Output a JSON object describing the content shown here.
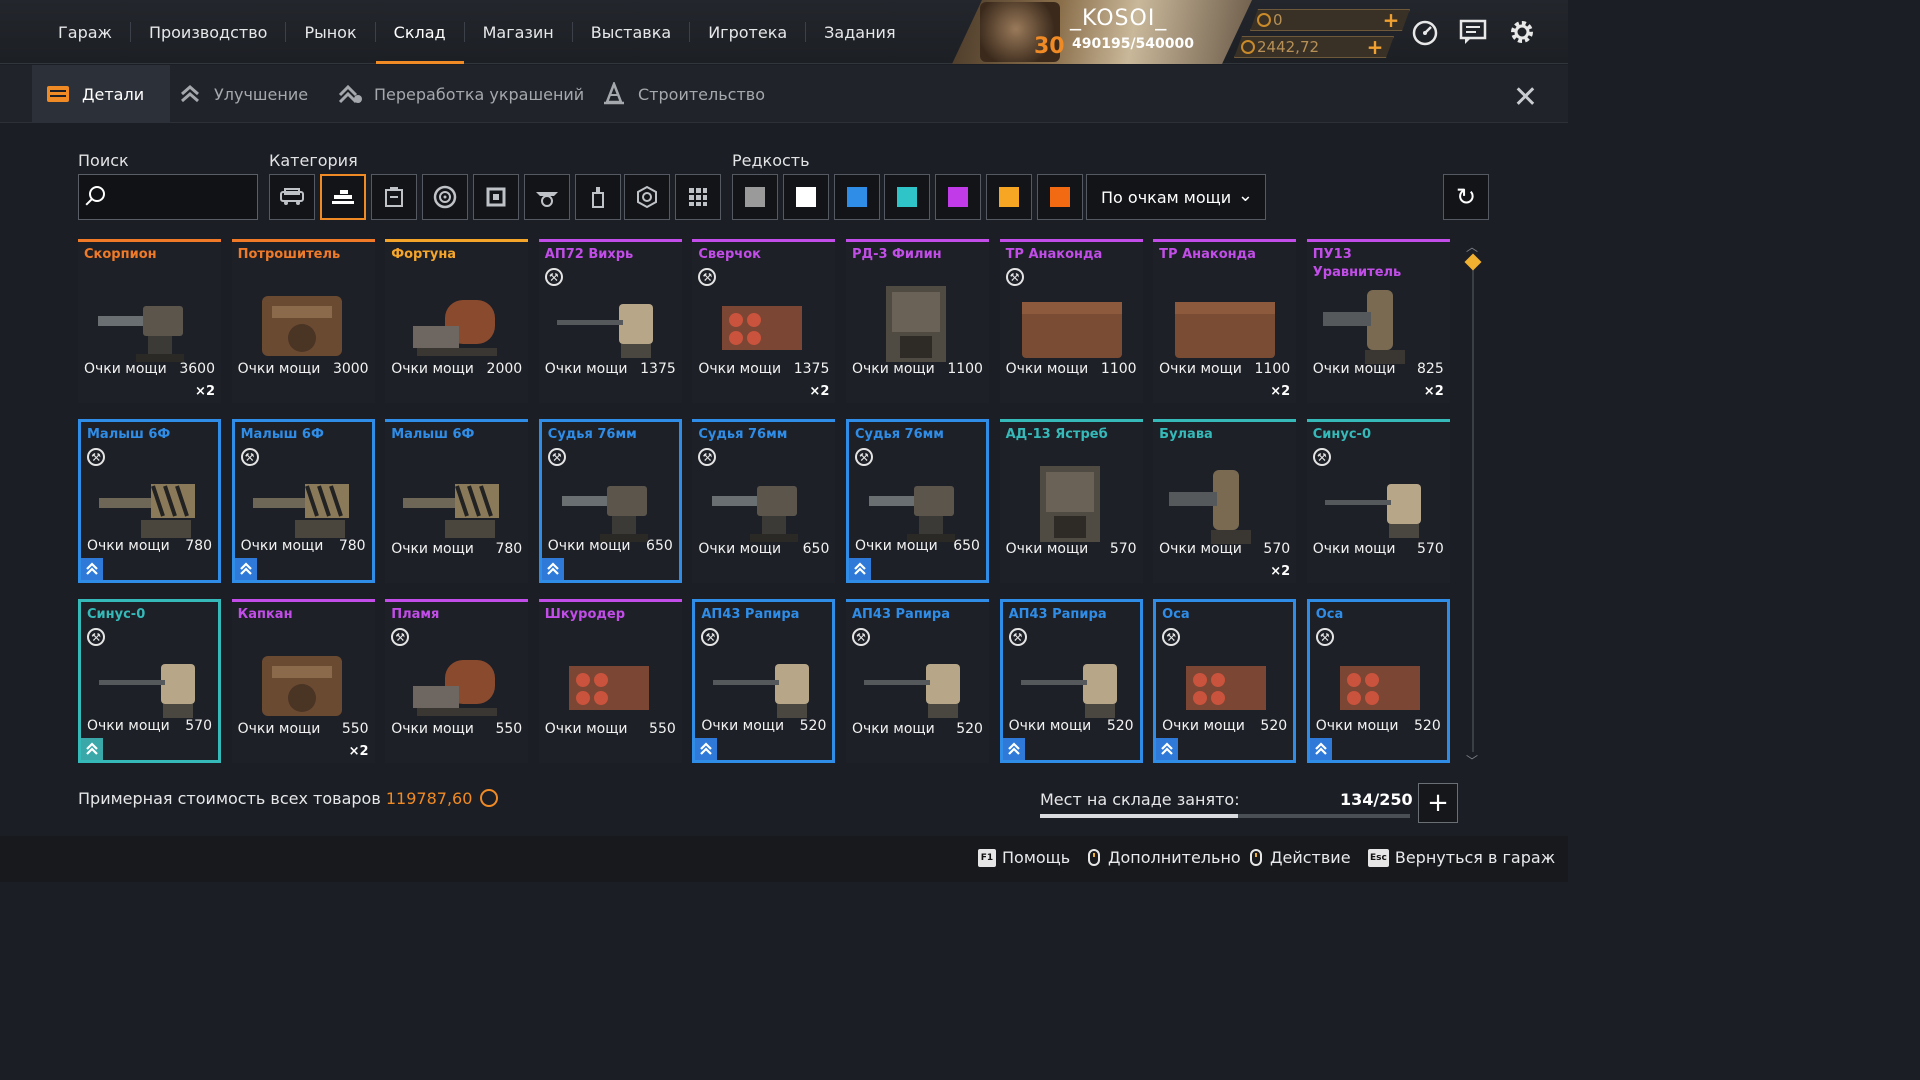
{
  "nav": {
    "items": [
      "Гараж",
      "Производство",
      "Рынок",
      "Склад",
      "Магазин",
      "Выставка",
      "Игротека",
      "Задания"
    ],
    "active_index": 3
  },
  "profile": {
    "level": "30",
    "name": "_KOSOI_",
    "xp": "490195/540000"
  },
  "currencies": [
    {
      "value": "0",
      "icon": "coin-icon"
    },
    {
      "value": "2442,72",
      "icon": "coin-icon"
    }
  ],
  "subtabs": [
    "Детали",
    "Улучшение",
    "Переработка украшений",
    "Строительство"
  ],
  "filters": {
    "search_label": "Поиск",
    "category_label": "Категория",
    "rarity_label": "Редкость",
    "sort_value": "По очкам мощи",
    "rarity_colors": [
      "#9a9a9a",
      "#ffffff",
      "#2f8de8",
      "#2ec4c8",
      "#c23be8",
      "#f6a623",
      "#f26a12"
    ]
  },
  "power_label": "Очки мощи",
  "items": [
    {
      "name": "Скорпион",
      "power": "3600",
      "count": "×2",
      "rarity": "#f07a28",
      "nocraft": false,
      "framed": false,
      "upgradable": false
    },
    {
      "name": "Потрошитель",
      "power": "3000",
      "count": "",
      "rarity": "#f07a28",
      "nocraft": false,
      "framed": false,
      "upgradable": false
    },
    {
      "name": "Фортуна",
      "power": "2000",
      "count": "",
      "rarity": "#f5a62a",
      "nocraft": false,
      "framed": false,
      "upgradable": false
    },
    {
      "name": "АП72 Вихрь",
      "power": "1375",
      "count": "",
      "rarity": "#c24de8",
      "nocraft": true,
      "framed": false,
      "upgradable": false
    },
    {
      "name": "Сверчок",
      "power": "1375",
      "count": "×2",
      "rarity": "#c24de8",
      "nocraft": true,
      "framed": false,
      "upgradable": false
    },
    {
      "name": "РД-3 Филин",
      "power": "1100",
      "count": "",
      "rarity": "#c24de8",
      "nocraft": false,
      "framed": false,
      "upgradable": false
    },
    {
      "name": "ТР Анаконда",
      "power": "1100",
      "count": "",
      "rarity": "#c24de8",
      "nocraft": true,
      "framed": false,
      "upgradable": false
    },
    {
      "name": "ТР Анаконда",
      "power": "1100",
      "count": "×2",
      "rarity": "#c24de8",
      "nocraft": false,
      "framed": false,
      "upgradable": false
    },
    {
      "name": "ПУ13 Уравнитель",
      "power": "825",
      "count": "×2",
      "rarity": "#c24de8",
      "nocraft": false,
      "framed": false,
      "upgradable": false
    },
    {
      "name": "Малыш 6Ф",
      "power": "780",
      "count": "",
      "rarity": "#2f8de8",
      "nocraft": true,
      "framed": true,
      "upgradable": true
    },
    {
      "name": "Малыш 6Ф",
      "power": "780",
      "count": "",
      "rarity": "#2f8de8",
      "nocraft": true,
      "framed": true,
      "upgradable": true
    },
    {
      "name": "Малыш 6Ф",
      "power": "780",
      "count": "",
      "rarity": "#2f8de8",
      "nocraft": false,
      "framed": false,
      "upgradable": false
    },
    {
      "name": "Судья 76мм",
      "power": "650",
      "count": "",
      "rarity": "#2f8de8",
      "nocraft": true,
      "framed": true,
      "upgradable": true
    },
    {
      "name": "Судья 76мм",
      "power": "650",
      "count": "",
      "rarity": "#2f8de8",
      "nocraft": true,
      "framed": false,
      "upgradable": false
    },
    {
      "name": "Судья 76мм",
      "power": "650",
      "count": "",
      "rarity": "#2f8de8",
      "nocraft": true,
      "framed": true,
      "upgradable": true
    },
    {
      "name": "АД-13 Ястреб",
      "power": "570",
      "count": "",
      "rarity": "#35b9b9",
      "nocraft": false,
      "framed": false,
      "upgradable": false
    },
    {
      "name": "Булава",
      "power": "570",
      "count": "×2",
      "rarity": "#35b9b9",
      "nocraft": false,
      "framed": false,
      "upgradable": false
    },
    {
      "name": "Синус-0",
      "power": "570",
      "count": "",
      "rarity": "#35b9b9",
      "nocraft": true,
      "framed": false,
      "upgradable": false
    },
    {
      "name": "Синус-0",
      "power": "570",
      "count": "",
      "rarity": "#35b9b9",
      "nocraft": true,
      "framed": true,
      "upgradable": true
    },
    {
      "name": "Капкан",
      "power": "550",
      "count": "×2",
      "rarity": "#c24de8",
      "nocraft": false,
      "framed": false,
      "upgradable": false
    },
    {
      "name": "Пламя",
      "power": "550",
      "count": "",
      "rarity": "#c24de8",
      "nocraft": true,
      "framed": false,
      "upgradable": false
    },
    {
      "name": "Шкуродер",
      "power": "550",
      "count": "",
      "rarity": "#c24de8",
      "nocraft": false,
      "framed": false,
      "upgradable": false
    },
    {
      "name": "АП43 Рапира",
      "power": "520",
      "count": "",
      "rarity": "#2f8de8",
      "nocraft": true,
      "framed": true,
      "upgradable": true
    },
    {
      "name": "АП43 Рапира",
      "power": "520",
      "count": "",
      "rarity": "#2f8de8",
      "nocraft": true,
      "framed": false,
      "upgradable": false
    },
    {
      "name": "АП43 Рапира",
      "power": "520",
      "count": "",
      "rarity": "#2f8de8",
      "nocraft": true,
      "framed": true,
      "upgradable": true
    },
    {
      "name": "Оса",
      "power": "520",
      "count": "",
      "rarity": "#2f8de8",
      "nocraft": true,
      "framed": true,
      "upgradable": true
    },
    {
      "name": "Оса",
      "power": "520",
      "count": "",
      "rarity": "#2f8de8",
      "nocraft": true,
      "framed": true,
      "upgradable": true
    }
  ],
  "footer": {
    "total_label": "Примерная стоимость всех товаров",
    "total_value": "119787,60",
    "capacity_label": "Мест на складе занято:",
    "capacity_value": "134/250",
    "capacity_fraction": 0.536
  },
  "hints": [
    {
      "key": "F1",
      "label": "Помощь"
    },
    {
      "key": "mouse",
      "label": "Дополнительно"
    },
    {
      "key": "mouse",
      "label": "Действие"
    },
    {
      "key": "Esc",
      "label": "Вернуться в гараж"
    }
  ]
}
